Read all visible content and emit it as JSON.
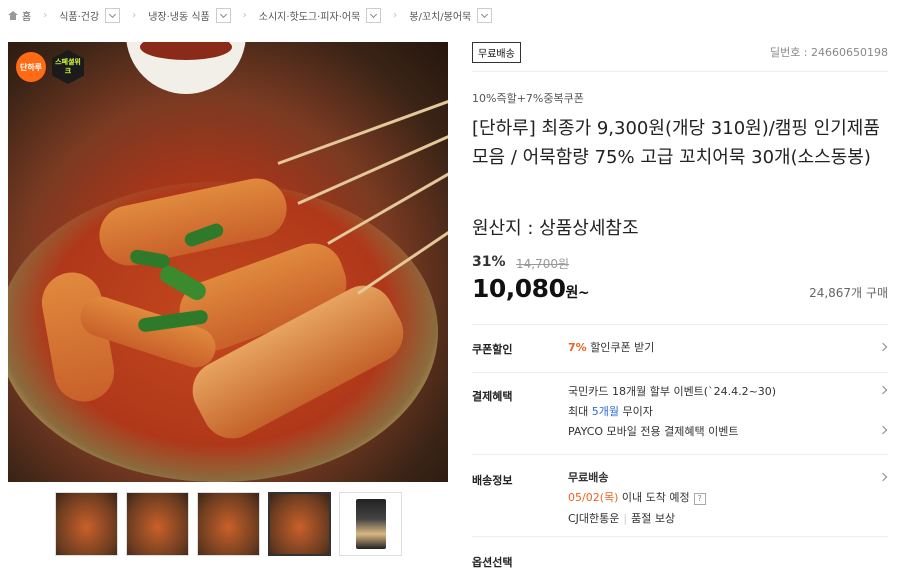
{
  "breadcrumb": {
    "home": "홈",
    "items": [
      "식품·건강",
      "냉장·냉동 식품",
      "소시지·핫도그·피자·어묵",
      "봉/꼬치/봉어묵"
    ]
  },
  "image": {
    "badge_left": "단하루",
    "badge_right": "스페셜위크"
  },
  "product": {
    "free_shipping_tag": "무료배송",
    "deal_no": "딜번호 : 24660650198",
    "coupon_tag": "10%즉할+7%중복쿠폰",
    "title": "[단하루] 최종가 9,300원(개당 310원)/캠핑 인기제품 모음 / 어묵함량 75% 고급 꼬치어묵 30개(소스동봉)",
    "origin": "원산지 : 상품상세참조",
    "discount_pct": "31%",
    "original_price": "14,700원",
    "price": "10,080",
    "price_suffix": "원~",
    "sold_count": "24,867개 구매"
  },
  "coupon": {
    "label": "쿠폰할인",
    "pct": "7%",
    "text": "할인쿠폰 받기"
  },
  "payment": {
    "label": "결제혜택",
    "line1": "국민카드 18개월 할부 이벤트(`24.4.2~30)",
    "line2_pre": "최대 ",
    "line2_highlight": "5개월",
    "line2_post": " 무이자",
    "line3": "PAYCO 모바일 전용 결제혜택 이벤트"
  },
  "shipping": {
    "label": "배송정보",
    "title": "무료배송",
    "date": "05/02(목)",
    "date_suffix": " 이내 도착 예정",
    "help": "?",
    "carrier": "CJ대한통운",
    "guarantee": "품절 보상"
  },
  "options": {
    "label": "옵션선택"
  }
}
